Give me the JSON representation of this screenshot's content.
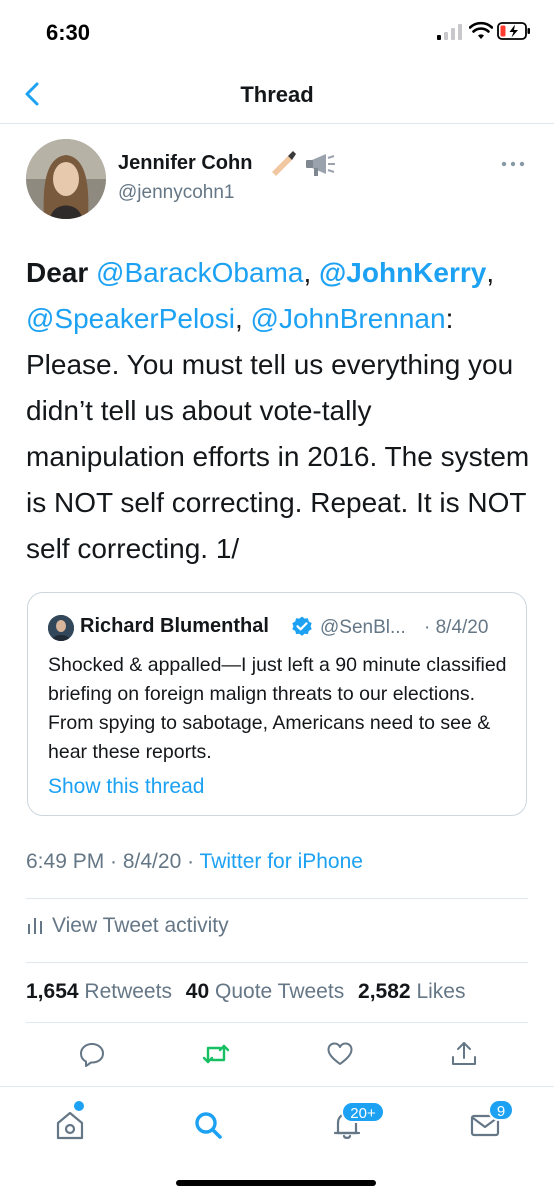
{
  "status_bar": {
    "time": "6:30"
  },
  "nav": {
    "title": "Thread"
  },
  "author": {
    "name": "Jennifer Cohn",
    "handle": "@jennycohn1"
  },
  "tweet": {
    "parts": [
      {
        "text": "Dear ",
        "style": "bold"
      },
      {
        "text": "@BarackObama",
        "style": "mention"
      },
      {
        "text": ", ",
        "style": "plain"
      },
      {
        "text": "@JohnKerry",
        "style": "mention-bold"
      },
      {
        "text": ", ",
        "style": "plain"
      },
      {
        "text": "@SpeakerPelosi",
        "style": "mention"
      },
      {
        "text": ", ",
        "style": "plain"
      },
      {
        "text": "@JohnBrennan",
        "style": "mention"
      },
      {
        "text": ": Please. You must tell us everything you didn’t tell us about vote-tally manipulation efforts in 2016. The system is NOT self correcting. Repeat. It is NOT self correcting. 1/",
        "style": "plain"
      }
    ]
  },
  "quote": {
    "name": "Richard Blumenthal",
    "handle": "@SenBl...",
    "date": "· 8/4/20",
    "text": "Shocked & appalled—I just left a 90 minute classified briefing on foreign malign threats to our elections. From spying to sabotage, Americans need to see & hear these reports.",
    "link": "Show this thread"
  },
  "meta": {
    "time": "6:49 PM · 8/4/20 · ",
    "client": "Twitter for iPhone"
  },
  "activity": {
    "label": "View Tweet activity"
  },
  "stats": {
    "retweets": {
      "count": "1,654",
      "label": "Retweets"
    },
    "quotes": {
      "count": "40",
      "label": "Quote Tweets"
    },
    "likes": {
      "count": "2,582",
      "label": "Likes"
    }
  },
  "tab_bar": {
    "notifications_badge": "20+",
    "messages_badge": "9"
  },
  "colors": {
    "accent": "#1da1f2",
    "retweet": "#17bf63",
    "secondary_text": "#657786"
  },
  "icons": [
    "back-icon",
    "more-icon",
    "verified-icon",
    "reply-icon",
    "retweet-icon",
    "like-icon",
    "share-icon",
    "home-icon",
    "search-icon",
    "notifications-icon",
    "messages-icon"
  ]
}
